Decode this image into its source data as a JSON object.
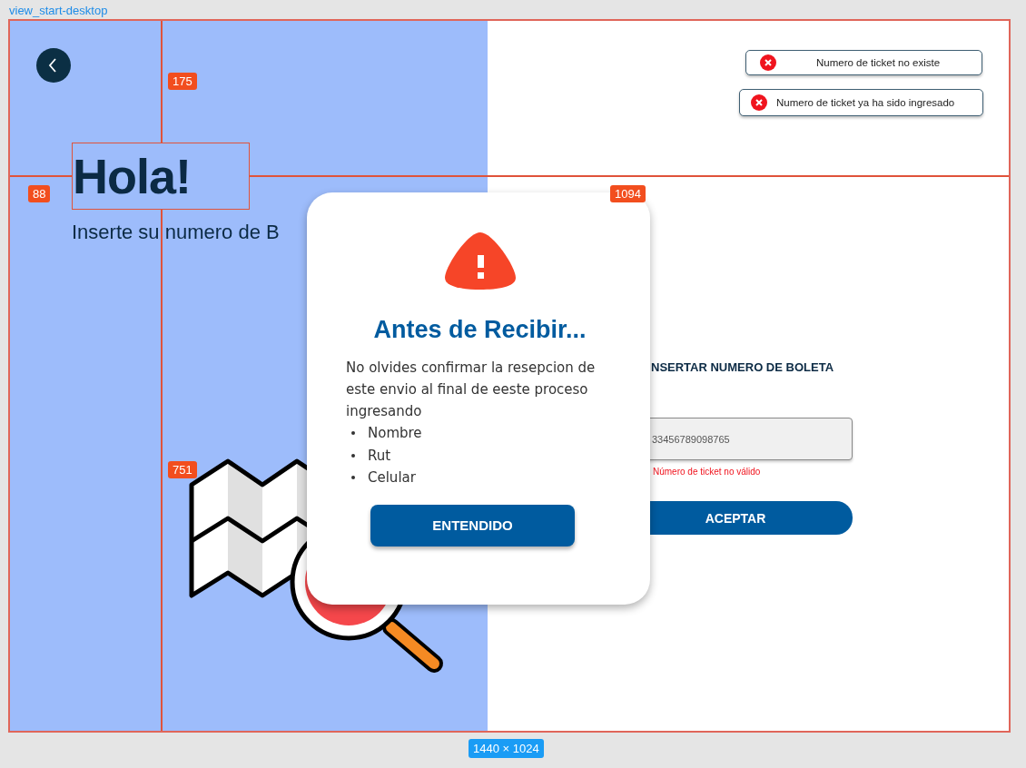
{
  "canvas": {
    "frame_label": "view_start-desktop",
    "size_badge": "1440 × 1024",
    "measurements": [
      "175",
      "88",
      "1094",
      "751"
    ]
  },
  "page": {
    "greeting": "Hola!",
    "subtitle": "Inserte su numero de B",
    "form": {
      "heading": "NSERTAR NUMERO DE BOLETA",
      "field_value": "33456789098765",
      "error": "Número de ticket no válido",
      "submit": "ACEPTAR"
    }
  },
  "toasts": [
    {
      "message": "Numero de ticket no existe"
    },
    {
      "message": "Numero de ticket ya ha sido ingresado"
    }
  ],
  "modal": {
    "title": "Antes de Recibir...",
    "body": "No olvides confirmar la resepcion de este envio al final de eeste proceso ingresando",
    "items": [
      "Nombre",
      "Rut",
      "Celular"
    ],
    "button": "ENTENDIDO"
  }
}
